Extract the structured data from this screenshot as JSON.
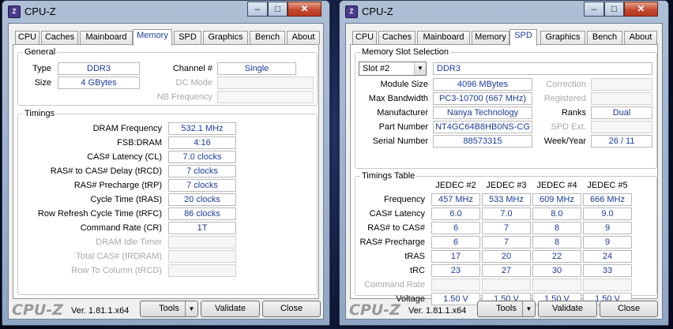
{
  "left": {
    "title": "CPU-Z",
    "tabs": [
      "CPU",
      "Caches",
      "Mainboard",
      "Memory",
      "SPD",
      "Graphics",
      "Bench",
      "About"
    ],
    "general": {
      "group_label": "General",
      "type_label": "Type",
      "type_value": "DDR3",
      "size_label": "Size",
      "size_value": "4 GBytes",
      "channel_label": "Channel #",
      "channel_value": "Single",
      "dcmode_label": "DC Mode",
      "dcmode_value": "",
      "nbfreq_label": "NB Frequency",
      "nbfreq_value": ""
    },
    "timings": {
      "group_label": "Timings",
      "rows": [
        {
          "label": "DRAM Frequency",
          "value": "532.1 MHz",
          "enabled": true
        },
        {
          "label": "FSB:DRAM",
          "value": "4:16",
          "enabled": true
        },
        {
          "label": "CAS# Latency (CL)",
          "value": "7.0 clocks",
          "enabled": true
        },
        {
          "label": "RAS# to CAS# Delay (tRCD)",
          "value": "7 clocks",
          "enabled": true
        },
        {
          "label": "RAS# Precharge (tRP)",
          "value": "7 clocks",
          "enabled": true
        },
        {
          "label": "Cycle Time (tRAS)",
          "value": "20 clocks",
          "enabled": true
        },
        {
          "label": "Row Refresh Cycle Time (tRFC)",
          "value": "86 clocks",
          "enabled": true
        },
        {
          "label": "Command Rate (CR)",
          "value": "1T",
          "enabled": true
        },
        {
          "label": "DRAM Idle Timer",
          "value": "",
          "enabled": false
        },
        {
          "label": "Total CAS# (tRDRAM)",
          "value": "",
          "enabled": false
        },
        {
          "label": "Row To Column (tRCD)",
          "value": "",
          "enabled": false
        }
      ]
    }
  },
  "right": {
    "title": "CPU-Z",
    "tabs": [
      "CPU",
      "Caches",
      "Mainboard",
      "Memory",
      "SPD",
      "Graphics",
      "Bench",
      "About"
    ],
    "slot": {
      "group_label": "Memory Slot Selection",
      "selected": "Slot #2",
      "type": "DDR3",
      "module_size_label": "Module Size",
      "module_size": "4096 MBytes",
      "bandwidth_label": "Max Bandwidth",
      "bandwidth": "PC3-10700 (667 MHz)",
      "manufacturer_label": "Manufacturer",
      "manufacturer": "Nanya Technology",
      "part_label": "Part Number",
      "part": "NT4GC64B8HB0NS-CG",
      "serial_label": "Serial Number",
      "serial": "88573315",
      "correction_label": "Correction",
      "correction": "",
      "registered_label": "Registered",
      "registered": "",
      "ranks_label": "Ranks",
      "ranks": "Dual",
      "spdext_label": "SPD Ext.",
      "spdext": "",
      "weekyear_label": "Week/Year",
      "weekyear": "26 / 11"
    },
    "timings_table": {
      "group_label": "Timings Table",
      "columns": [
        "JEDEC #2",
        "JEDEC #3",
        "JEDEC #4",
        "JEDEC #5"
      ],
      "rows": [
        {
          "label": "Frequency",
          "enabled": true,
          "values": [
            "457 MHz",
            "533 MHz",
            "609 MHz",
            "666 MHz"
          ]
        },
        {
          "label": "CAS# Latency",
          "enabled": true,
          "values": [
            "6.0",
            "7.0",
            "8.0",
            "9.0"
          ]
        },
        {
          "label": "RAS# to CAS#",
          "enabled": true,
          "values": [
            "6",
            "7",
            "8",
            "9"
          ]
        },
        {
          "label": "RAS# Precharge",
          "enabled": true,
          "values": [
            "6",
            "7",
            "8",
            "9"
          ]
        },
        {
          "label": "tRAS",
          "enabled": true,
          "values": [
            "17",
            "20",
            "22",
            "24"
          ]
        },
        {
          "label": "tRC",
          "enabled": true,
          "values": [
            "23",
            "27",
            "30",
            "33"
          ]
        },
        {
          "label": "Command Rate",
          "enabled": false,
          "values": [
            "",
            "",
            "",
            ""
          ]
        },
        {
          "label": "Voltage",
          "enabled": true,
          "values": [
            "1.50 V",
            "1.50 V",
            "1.50 V",
            "1.50 V"
          ]
        }
      ]
    }
  },
  "footer": {
    "brand": "CPU-Z",
    "version": "Ver. 1.81.1.x64",
    "tools": "Tools",
    "validate": "Validate",
    "close": "Close"
  },
  "window_controls": {
    "minimize": "–",
    "maximize": "□",
    "close": "✕"
  }
}
